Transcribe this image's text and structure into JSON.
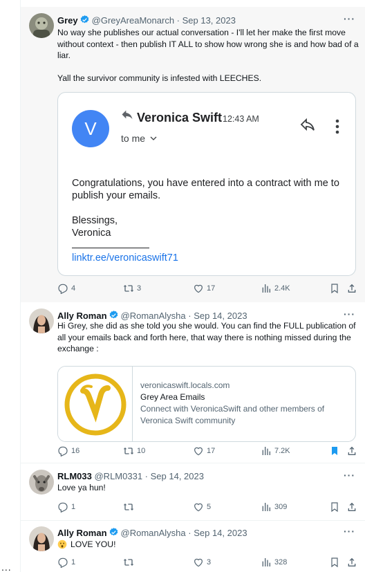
{
  "page": {
    "more_label": "..."
  },
  "tweets": [
    {
      "name": "Grey",
      "handle": "@GreyAreaMonarch",
      "date": "Sep 13, 2023",
      "text1": "No way she publishes our actual conversation - I'll let her make the first move without context - then publish IT ALL to show how wrong she is and how bad of a liar.",
      "text2": "Yall the survivor community is infested with LEECHES.",
      "email": {
        "avatar_letter": "V",
        "sender": "Veronica Swift",
        "time": "12:43 AM",
        "to": "to me",
        "body1": "Congratulations, you have entered into a contract with me to publish your emails.",
        "body2": "Blessings,",
        "body3": "Veronica",
        "link": "linktr.ee/veronicaswift71"
      },
      "replies": "4",
      "reposts": "3",
      "likes": "17",
      "views": "2.4K"
    },
    {
      "name": "Ally Roman",
      "handle": "@RomanAlysha",
      "date": "Sep 14, 2023",
      "text": "Hi Grey, she did as she told you she would. You can find the FULL publication of all your emails back and forth here, that way there is nothing missed during the exchange :",
      "card": {
        "domain": "veronicaswift.locals.com",
        "title": "Grey Area Emails",
        "desc": "Connect with VeronicaSwift and other members of Veronica Swift community"
      },
      "replies": "16",
      "reposts": "10",
      "likes": "17",
      "views": "7.2K"
    },
    {
      "name": "RLM033",
      "handle": "@RLM0331",
      "date": "Sep 14, 2023",
      "text": "Love ya hun!",
      "replies": "1",
      "reposts": "",
      "likes": "5",
      "views": "309"
    },
    {
      "name": "Ally Roman",
      "handle": "@RomanAlysha",
      "date": "Sep 14, 2023",
      "text": "LOVE YOU!",
      "replies": "1",
      "reposts": "",
      "likes": "3",
      "views": "328"
    }
  ],
  "colors": {
    "verified": "#1d9bf0",
    "bookmark_active": "#1d9bf0",
    "email_avatar": "#4285f4",
    "link": "#1a73e8",
    "card_gold": "#e6b619"
  }
}
